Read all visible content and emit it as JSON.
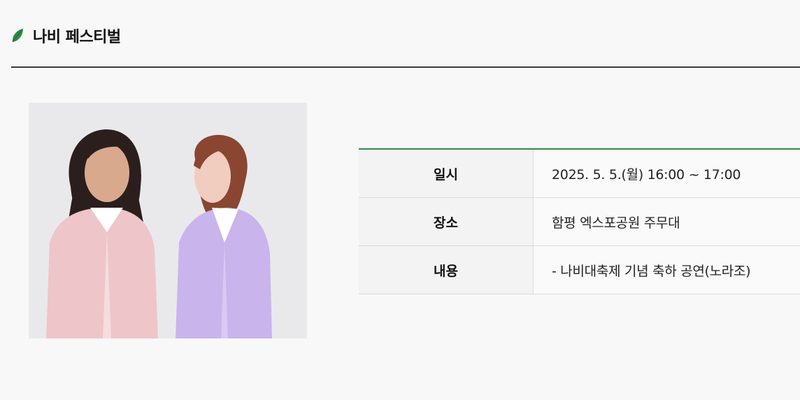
{
  "section": {
    "icon": "leaf-icon",
    "title": "나비 페스티벌",
    "accent_color": "#2e8b47"
  },
  "photo": {
    "alt": "Two performers in pink and lavender suits"
  },
  "info": {
    "rows": [
      {
        "label": "일시",
        "value": "2025. 5. 5.(월) 16:00 ~ 17:00"
      },
      {
        "label": "장소",
        "value": "함평 엑스포공원 주무대"
      },
      {
        "label": "내용",
        "value": "- 나비대축제 기념 축하 공연(노라조)"
      }
    ]
  }
}
